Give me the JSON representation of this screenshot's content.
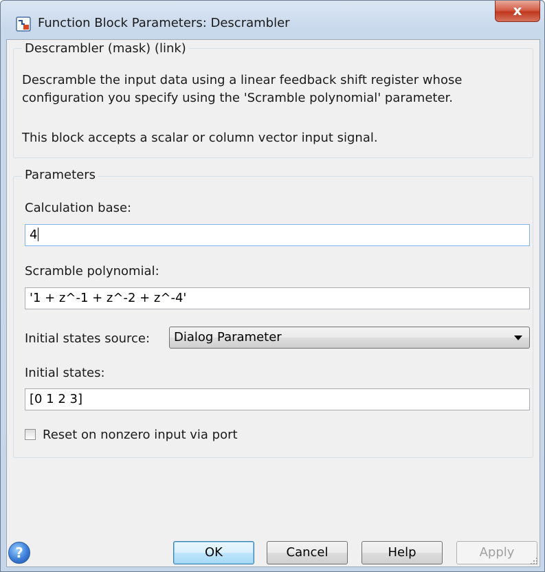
{
  "window": {
    "title": "Function Block Parameters: Descrambler",
    "close_glyph": "x"
  },
  "description_group": {
    "legend": "Descrambler (mask) (link)",
    "line1": "Descramble the input data using a linear feedback shift register whose",
    "line2": "configuration you specify using the 'Scramble polynomial' parameter.",
    "line3": "This block accepts a scalar or column vector input signal."
  },
  "parameters": {
    "legend": "Parameters",
    "calculation_base": {
      "label": "Calculation base:",
      "value": "4"
    },
    "scramble_polynomial": {
      "label": "Scramble polynomial:",
      "value": "'1 + z^-1 + z^-2 + z^-4'"
    },
    "initial_states_source": {
      "label": "Initial states source:",
      "value": "Dialog Parameter"
    },
    "initial_states": {
      "label": "Initial states:",
      "value": "[0 1 2 3]"
    },
    "reset_checkbox": {
      "label": "Reset on nonzero input via port",
      "checked": false
    }
  },
  "buttons": {
    "help_glyph": "?",
    "ok": "OK",
    "cancel": "Cancel",
    "help": "Help",
    "apply": "Apply"
  },
  "icons": {
    "window": "simulink-block-icon",
    "help": "question-circle-icon",
    "dropdown": "chevron-down-icon",
    "resize": "resize-grip-icon"
  }
}
